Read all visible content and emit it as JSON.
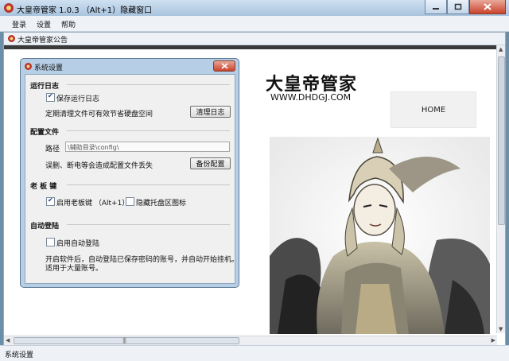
{
  "window": {
    "title": "大皇帝管家 1.0.3 （Alt+1）隐藏窗口"
  },
  "menu": [
    "登录",
    "设置",
    "帮助"
  ],
  "notice": {
    "label": "大皇帝管家公告"
  },
  "brand": {
    "title": "大皇帝管家",
    "url": "WWW.DHDGJ.COM",
    "home": "HOME"
  },
  "status": {
    "text": "系统设置"
  },
  "dialog": {
    "title": "系统设置",
    "log": {
      "heading": "运行日志",
      "save_label": "保存运行日志",
      "save_checked": true,
      "hint": "定期清理文件可有效节省硬盘空间",
      "clear_button": "清理日志"
    },
    "config": {
      "heading": "配置文件",
      "path_label": "路径",
      "path_value": "\\辅助目录\\config\\",
      "hint": "误删、断电等会造成配置文件丢失",
      "backup_button": "备份配置"
    },
    "bosskey": {
      "heading": "老 板 键",
      "enable_label": "启用老板键 （Alt+1）",
      "enable_checked": true,
      "tray_label": "隐藏托盘区图标",
      "tray_checked": false
    },
    "autologin": {
      "heading": "自动登陆",
      "enable_label": "启用自动登陆",
      "enable_checked": false,
      "desc_line1": "开启软件后，自动登陆已保存密码的账号，并自动开始挂机。",
      "desc_line2": "适用于大量账号。"
    }
  }
}
